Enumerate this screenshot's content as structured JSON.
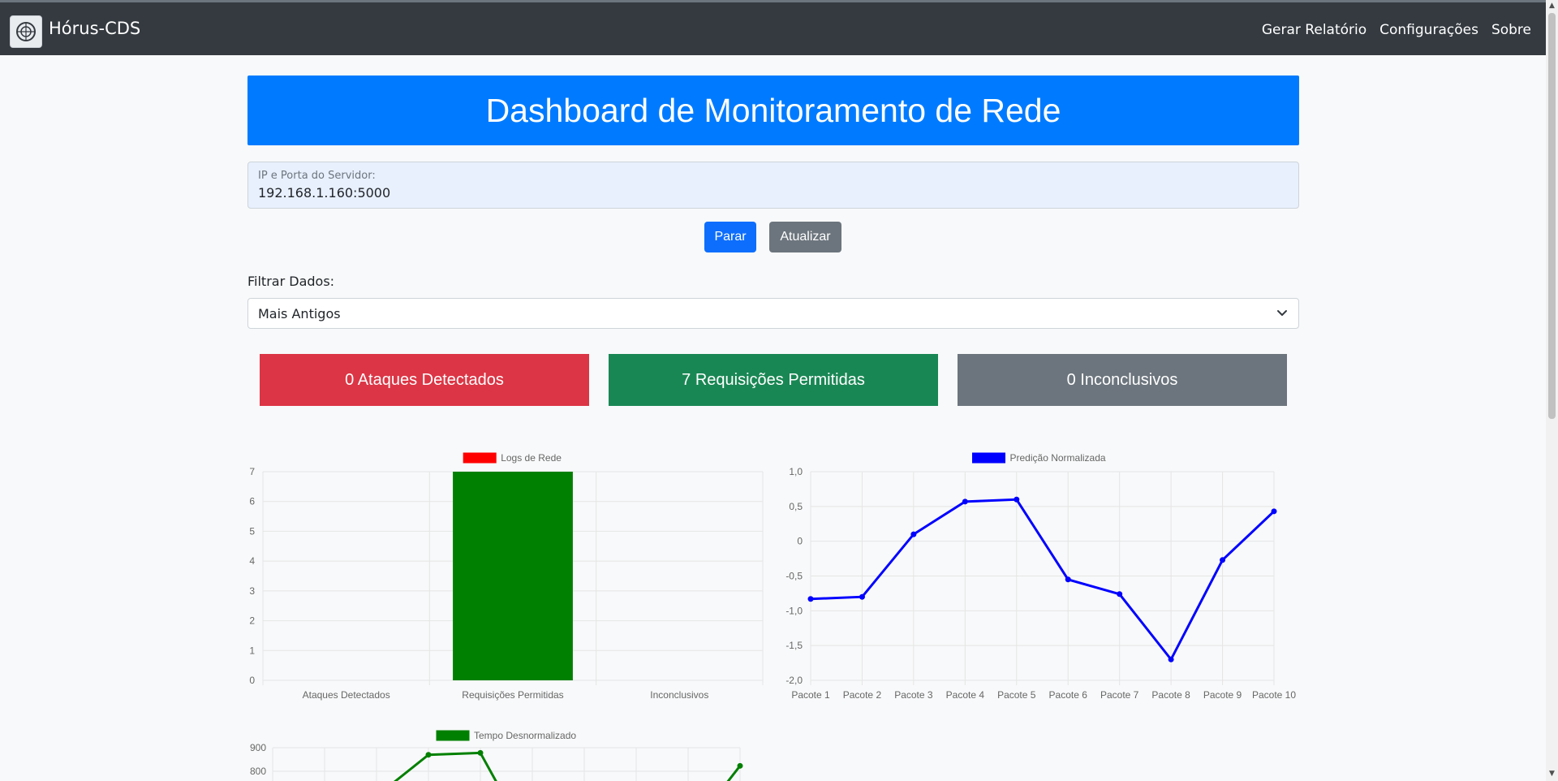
{
  "navbar": {
    "brand": "Hórus-CDS",
    "links": [
      "Gerar Relatório",
      "Configurações",
      "Sobre"
    ]
  },
  "hero": {
    "title": "Dashboard de Monitoramento de Rede"
  },
  "server": {
    "label": "IP e Porta do Servidor:",
    "value": "192.168.1.160:5000"
  },
  "buttons": {
    "stop": "Parar",
    "refresh": "Atualizar"
  },
  "filter": {
    "label": "Filtrar Dados:",
    "selected": "Mais Antigos"
  },
  "stats": {
    "attacks": "0 Ataques Detectados",
    "allowed": "7 Requisições Permitidas",
    "inconclusive": "0 Inconclusivos"
  },
  "colors": {
    "primary": "#007bff",
    "danger": "#dc3545",
    "success": "#198754",
    "secondary": "#6c757d",
    "navbar": "#343a40"
  },
  "chart_data": [
    {
      "type": "bar",
      "legend": "Logs de Rede",
      "legend_color": "#ff0000",
      "categories": [
        "Ataques Detectados",
        "Requisições Permitidas",
        "Inconclusivos"
      ],
      "values": [
        0,
        7,
        0
      ],
      "bar_color": "#008000",
      "ylim": [
        0,
        7
      ],
      "yticks": [
        "0",
        "1",
        "2",
        "3",
        "4",
        "5",
        "6",
        "7"
      ],
      "grid": true
    },
    {
      "type": "line",
      "legend": "Predição Normalizada",
      "legend_color": "#0000ff",
      "categories": [
        "Pacote 1",
        "Pacote 2",
        "Pacote 3",
        "Pacote 4",
        "Pacote 5",
        "Pacote 6",
        "Pacote 7",
        "Pacote 8",
        "Pacote 9",
        "Pacote 10"
      ],
      "values": [
        -0.83,
        -0.8,
        0.1,
        0.57,
        0.6,
        -0.55,
        -0.76,
        -1.7,
        -0.27,
        0.43
      ],
      "ylim": [
        -2.0,
        1.0
      ],
      "yticks": [
        "1,0",
        "0,5",
        "0",
        "-0,5",
        "-1,0",
        "-1,5",
        "-2,0"
      ],
      "grid": true
    },
    {
      "type": "line",
      "legend": "Tempo Desnormalizado",
      "legend_color": "#008000",
      "yticks": [
        "900",
        "800"
      ],
      "visible_values": {
        "point_4": 870,
        "point_5": 878,
        "point_10": 823
      },
      "grid": true
    }
  ]
}
